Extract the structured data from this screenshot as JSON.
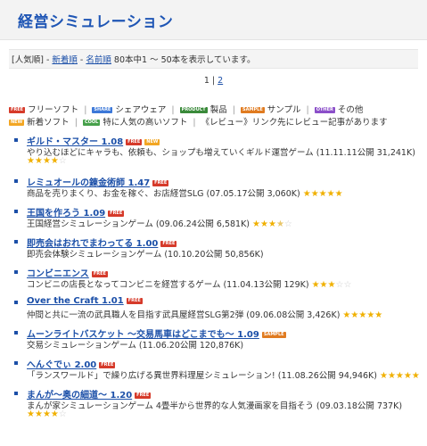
{
  "page_title": "経営シミュレーション",
  "sort": {
    "current": "[人気順]",
    "sep": " - ",
    "opt_new": "新着順",
    "opt_name": "名前順",
    "summary": "80本中1 ～ 50本を表示しています。"
  },
  "pager": {
    "current": "1",
    "divider": " | ",
    "next": "2"
  },
  "legend": {
    "free": "フリーソフト",
    "share": "シェアウェア",
    "product": "製品",
    "sample": "サンプル",
    "other": "その他",
    "new": "新着ソフト",
    "cool": "特に人気の高いソフト",
    "review_note": "《レビュー》リンク先にレビュー記事があります",
    "badge_free": "FREE",
    "badge_share": "SHARE",
    "badge_product": "PRODUCT",
    "badge_sample": "SAMPLE",
    "badge_other": "OTHER",
    "badge_new": "NEW",
    "badge_cool": "COOL",
    "divider": "|"
  },
  "items": [
    {
      "title": "ギルド・マスター 1.08",
      "badges": [
        "FREE",
        "NEW"
      ],
      "desc": "やり込むほどにキャラも、依頼も、ショップも増えていくギルド運営ゲーム (11.11.11公開 31,241K)",
      "rating": 4,
      "stars_inline": false
    },
    {
      "title": "レミュオールの錬金術師 1.47",
      "badges": [
        "FREE"
      ],
      "desc": "商品を売りまくり、お金を稼ぐ、お店経営SLG (07.05.17公開 3,060K)",
      "rating": 5,
      "stars_inline": true
    },
    {
      "title": "王国を作ろう 1.09",
      "badges": [
        "FREE"
      ],
      "desc": "王国経営シミュレーションゲーム (09.06.24公開 6,581K)",
      "rating": 3.5,
      "stars_inline": true
    },
    {
      "title": "即売会はおれでまわってる 1.00",
      "badges": [
        "FREE"
      ],
      "desc": "即売会体験シミュレーションゲーム (10.10.20公開 50,856K)",
      "rating": 0,
      "stars_inline": false
    },
    {
      "title": "コンビニエンス",
      "badges": [
        "FREE"
      ],
      "desc": "コンビニの店長となってコンビニを経営するゲーム (11.04.13公開 129K)",
      "rating": 3,
      "stars_inline": true
    },
    {
      "title": "Over the Craft 1.01",
      "badges": [
        "FREE"
      ],
      "desc": "仲間と共に一流の武具職人を目指す武具屋経営SLG第2弾 (09.06.08公開 3,426K)",
      "rating": 5,
      "stars_inline": true
    },
    {
      "title": "ムーンライトバスケット ～交易馬車はどこまでも～ 1.09",
      "badges": [
        "SAMPLE"
      ],
      "desc": "交易シミュレーションゲーム (11.06.20公開 120,876K)",
      "rating": 0,
      "stars_inline": false
    },
    {
      "title": "へんぐでぃ 2.00",
      "badges": [
        "FREE"
      ],
      "desc": "「ランスワールド」で繰り広げる異世界料理屋シミュレーション! (11.08.26公開 94,946K)",
      "rating": 5,
      "stars_inline": true
    },
    {
      "title": "まんが～奥の細道～ 1.20",
      "badges": [
        "FREE"
      ],
      "desc": "まんが家シミュレーションゲーム 4畳半から世界的な人気漫画家を目指そう (09.03.18公開 737K)",
      "rating": 4,
      "stars_inline": false
    }
  ]
}
